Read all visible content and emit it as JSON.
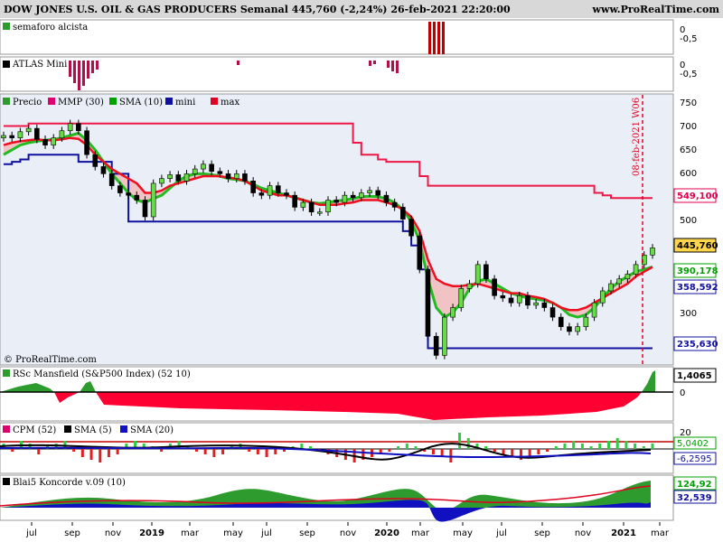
{
  "header": {
    "title": "DOW JONES U.S. OIL & GAS PRODUCERS Semanal 445,760 (-2,24%) 26-feb-2021 22:20:00",
    "site": "www.ProRealTime.com"
  },
  "panels": {
    "semaforo": {
      "label": "semaforo alcista",
      "tick": "0",
      "tick2": "-0,5"
    },
    "atlas": {
      "label": "ATLAS Mini",
      "tick": "0",
      "tick2": "-0,5"
    },
    "price": {
      "legend": [
        {
          "name": "Precio",
          "color": "#2e9b2e"
        },
        {
          "name": "MMP (30)",
          "color": "#e0006e"
        },
        {
          "name": "SMA (10)",
          "color": "#00a000"
        },
        {
          "name": "mini",
          "color": "#1010a0"
        },
        {
          "name": "max",
          "color": "#e00020"
        }
      ],
      "yticks": [
        "750",
        "700",
        "650",
        "600",
        "550",
        "500",
        "400",
        "300"
      ],
      "annotation": "08-feb-2021 W06",
      "copyright": "© ProRealTime.com",
      "badges": [
        {
          "text": "549,100",
          "color": "#e0004e"
        },
        {
          "text": "445,760",
          "color": "#000000"
        },
        {
          "text": "390,178",
          "color": "#00a000"
        },
        {
          "text": "358,592",
          "color": "#1010a0"
        },
        {
          "text": "235,630",
          "color": "#1010a0"
        }
      ]
    },
    "rsc": {
      "label": "RSc Mansfield (S&P500 Index) (52 10)",
      "value": "1,4065",
      "zero": "0"
    },
    "cpm": {
      "legend": [
        {
          "name": "CPM (52)",
          "color": "#e0006e"
        },
        {
          "name": "SMA (5)",
          "color": "#000000"
        },
        {
          "name": "SMA (20)",
          "color": "#1010c0"
        }
      ],
      "tick": "20",
      "values": [
        {
          "text": "5,0402",
          "color": "#00a000"
        },
        {
          "text": "-6,2595",
          "color": "#1010a0"
        }
      ]
    },
    "koncorde": {
      "label": "Blai5 Koncorde v.09 (10)",
      "values": [
        {
          "text": "124,92",
          "color": "#00a000"
        },
        {
          "text": "32,539",
          "color": "#1010a0"
        }
      ]
    }
  },
  "xaxis": [
    "jul",
    "sep",
    "nov",
    "2019",
    "mar",
    "may",
    "jul",
    "sep",
    "nov",
    "2020",
    "mar",
    "may",
    "jul",
    "sep",
    "nov",
    "2021",
    "mar"
  ],
  "chart_data": {
    "type": "candlestick",
    "title": "DOW JONES U.S. OIL & GAS PRODUCERS Semanal",
    "x": [
      "jul",
      "sep",
      "nov",
      "2019",
      "mar",
      "may",
      "jul",
      "sep",
      "nov",
      "2020",
      "mar",
      "may",
      "jul",
      "sep",
      "nov",
      "2021",
      "mar"
    ],
    "close_series": [
      680,
      675,
      688,
      695,
      672,
      660,
      675,
      690,
      705,
      690,
      640,
      615,
      600,
      575,
      560,
      555,
      545,
      510,
      580,
      590,
      598,
      585,
      600,
      610,
      620,
      605,
      600,
      590,
      600,
      585,
      560,
      555,
      575,
      560,
      555,
      530,
      540,
      520,
      520,
      545,
      540,
      555,
      550,
      560,
      565,
      555,
      540,
      530,
      505,
      470,
      400,
      260,
      220,
      300,
      320,
      360,
      370,
      410,
      380,
      345,
      340,
      330,
      345,
      325,
      330,
      320,
      300,
      280,
      270,
      280,
      300,
      330,
      355,
      370,
      380,
      390,
      410,
      430,
      445
    ],
    "max_series": [
      700,
      700,
      700,
      705,
      705,
      705,
      705,
      705,
      705,
      705,
      705,
      705,
      705,
      705,
      705,
      705,
      705,
      705,
      705,
      705,
      705,
      705,
      705,
      705,
      705,
      705,
      705,
      705,
      705,
      705,
      705,
      705,
      705,
      705,
      705,
      705,
      705,
      705,
      705,
      705,
      705,
      705,
      665,
      640,
      640,
      630,
      625,
      625,
      625,
      625,
      595,
      575,
      575,
      575,
      575,
      575,
      575,
      575,
      575,
      575,
      575,
      575,
      575,
      575,
      575,
      575,
      575,
      575,
      575,
      575,
      575,
      560,
      555,
      549,
      549,
      549,
      549,
      549,
      549
    ],
    "mini_series": [
      620,
      625,
      630,
      640,
      640,
      640,
      640,
      640,
      640,
      625,
      625,
      625,
      625,
      600,
      600,
      500,
      500,
      500,
      500,
      500,
      500,
      500,
      500,
      500,
      500,
      500,
      500,
      500,
      500,
      500,
      500,
      500,
      500,
      500,
      500,
      500,
      500,
      500,
      500,
      500,
      500,
      500,
      500,
      500,
      500,
      500,
      500,
      500,
      480,
      450,
      400,
      235,
      235,
      235,
      235,
      235,
      235,
      235,
      235,
      235,
      235,
      235,
      235,
      235,
      235,
      235,
      235,
      235,
      235,
      235,
      235,
      235,
      235,
      235,
      235,
      235,
      235,
      235,
      235
    ],
    "mmp_series": [
      660,
      665,
      668,
      670,
      672,
      670,
      670,
      672,
      675,
      673,
      660,
      640,
      625,
      610,
      600,
      590,
      580,
      560,
      560,
      565,
      575,
      580,
      585,
      590,
      595,
      595,
      595,
      592,
      590,
      585,
      575,
      565,
      560,
      555,
      555,
      550,
      545,
      540,
      535,
      535,
      535,
      538,
      540,
      545,
      545,
      545,
      540,
      535,
      525,
      510,
      480,
      420,
      380,
      370,
      365,
      365,
      368,
      370,
      365,
      360,
      355,
      350,
      350,
      345,
      342,
      338,
      330,
      320,
      315,
      315,
      320,
      330,
      340,
      350,
      360,
      370,
      385,
      395,
      405
    ],
    "sma_series": [
      640,
      650,
      660,
      665,
      668,
      670,
      672,
      675,
      680,
      685,
      670,
      650,
      625,
      600,
      580,
      560,
      545,
      540,
      548,
      555,
      570,
      585,
      595,
      600,
      600,
      598,
      595,
      590,
      588,
      585,
      578,
      570,
      565,
      560,
      555,
      550,
      545,
      540,
      538,
      540,
      543,
      545,
      548,
      552,
      553,
      552,
      548,
      540,
      525,
      500,
      460,
      380,
      320,
      300,
      310,
      330,
      360,
      375,
      380,
      370,
      360,
      350,
      345,
      340,
      338,
      335,
      330,
      320,
      305,
      300,
      305,
      320,
      340,
      360,
      375,
      385,
      395,
      400,
      405
    ]
  }
}
